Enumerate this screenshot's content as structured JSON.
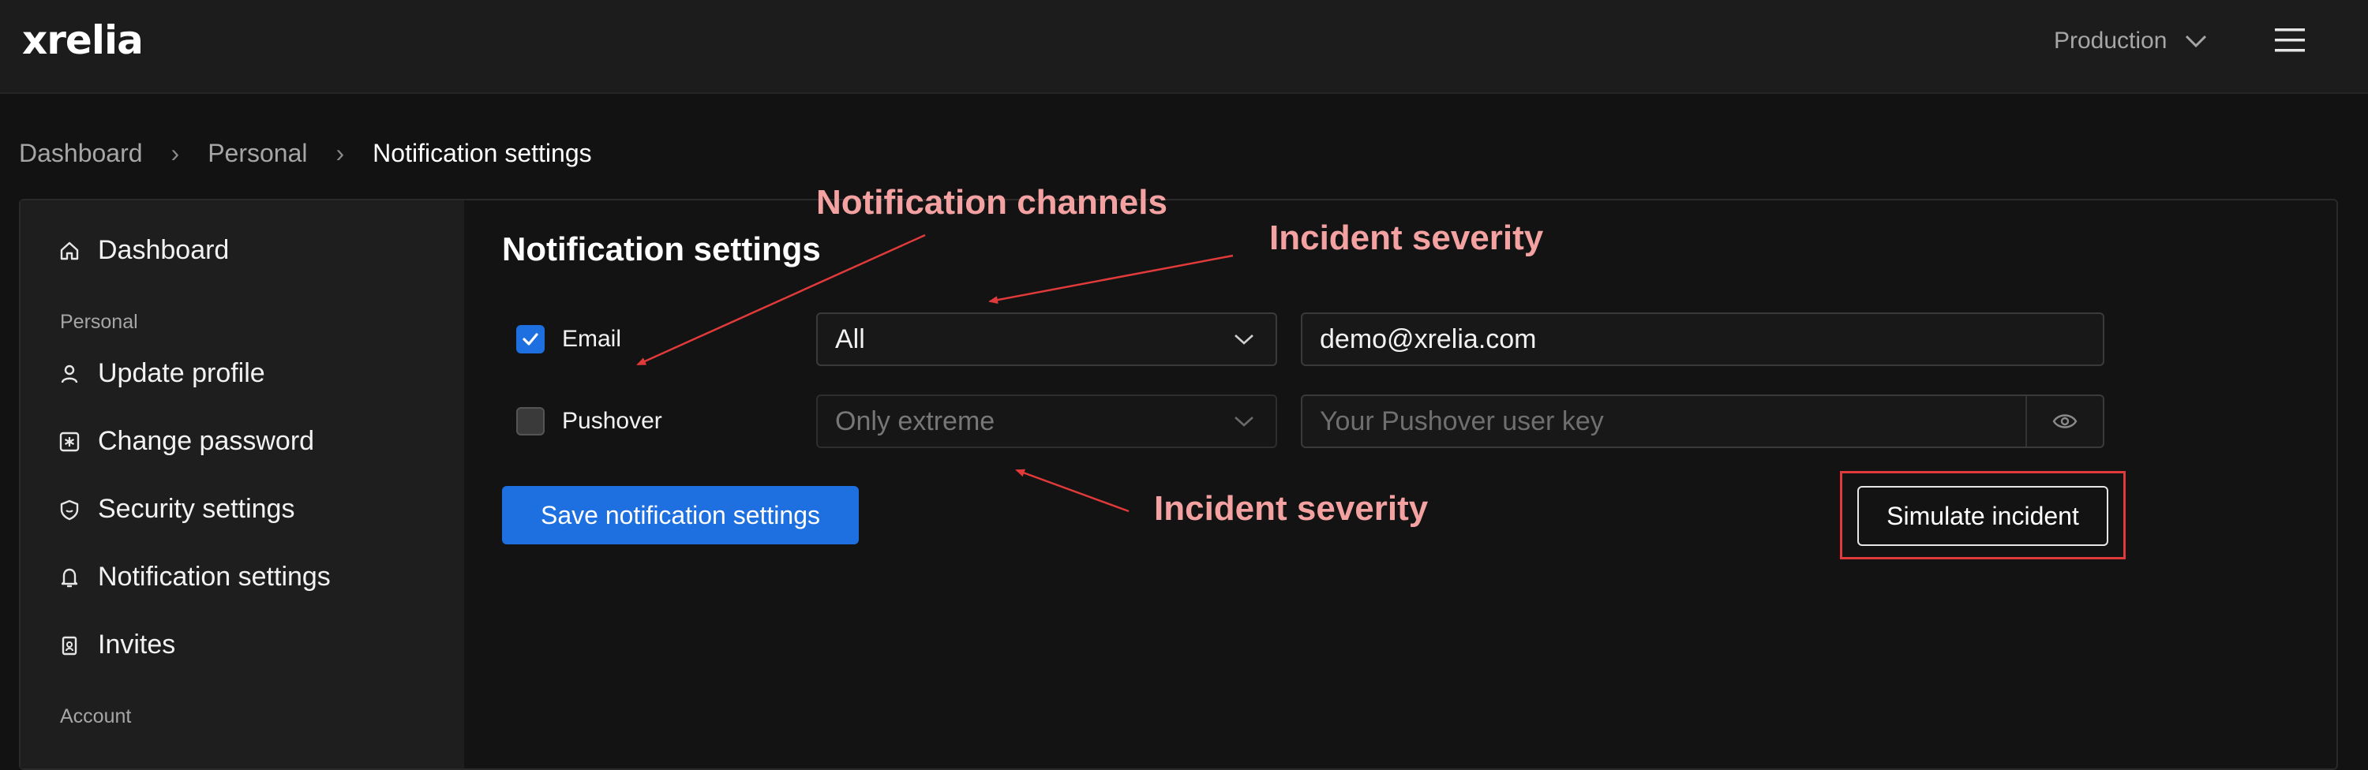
{
  "header": {
    "logo": "xrelia",
    "environment": "Production"
  },
  "breadcrumb": [
    "Dashboard",
    "Personal",
    "Notification settings"
  ],
  "sidebar": {
    "items": [
      {
        "label": "Dashboard",
        "icon": "home-icon"
      },
      {
        "section": "Personal"
      },
      {
        "label": "Update profile",
        "icon": "user-icon"
      },
      {
        "label": "Change password",
        "icon": "asterisk-icon"
      },
      {
        "label": "Security settings",
        "icon": "shield-icon"
      },
      {
        "label": "Notification settings",
        "icon": "bell-icon"
      },
      {
        "label": "Invites",
        "icon": "badge-icon"
      },
      {
        "section": "Account"
      }
    ]
  },
  "main": {
    "title": "Notification settings",
    "channels": [
      {
        "label": "Email",
        "checked": true,
        "severity": "All",
        "value": "demo@xrelia.com"
      },
      {
        "label": "Pushover",
        "checked": false,
        "severity": "Only extreme",
        "placeholder": "Your Pushover user key"
      }
    ],
    "save_label": "Save notification settings",
    "simulate_label": "Simulate incident"
  },
  "annotations": {
    "channels": "Notification channels",
    "severity_top": "Incident severity",
    "severity_bottom": "Incident severity"
  },
  "colors": {
    "accent": "#1e6fe0",
    "annotation": "#f3a1a1",
    "annotation_box": "#e03a3a"
  }
}
